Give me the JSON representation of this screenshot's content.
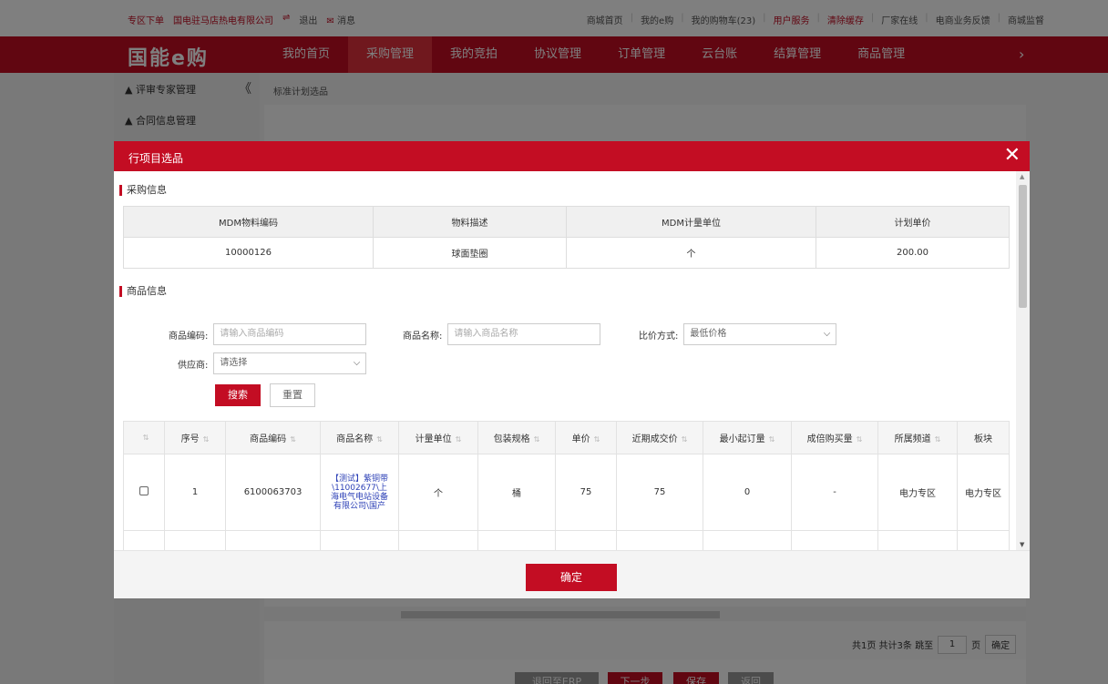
{
  "topbar": {
    "left": [
      "专区下单",
      "国电驻马店热电有限公司",
      "⇌",
      "退出",
      "消息"
    ],
    "right": [
      "商城首页",
      "我的e购",
      "我的购物车(23)",
      "用户服务",
      "清除缓存",
      "厂家在线",
      "电商业务反馈",
      "商城监督"
    ]
  },
  "nav": {
    "logo": "国能e购",
    "items": [
      "我的首页",
      "采购管理",
      "我的竞拍",
      "协议管理",
      "订单管理",
      "云台账",
      "结算管理",
      "商品管理"
    ],
    "active": "采购管理",
    "more": "›"
  },
  "sidebar": {
    "items": [
      "评审专家管理",
      "合同信息管理"
    ],
    "collapse": "《"
  },
  "breadcrumb": "标准计划选品",
  "pagination": {
    "summary": "共1页 共计3条 跳至",
    "page": "1",
    "unit": "页",
    "ok": "确定"
  },
  "bottom_buttons": [
    "退回至ERP",
    "下一步",
    "保存",
    "返回"
  ],
  "modal": {
    "title": "行项目选品",
    "close": "✕",
    "confirm": "确定",
    "purchase_section": "采购信息",
    "purchase_table": {
      "headers": [
        "MDM物料编码",
        "物料描述",
        "MDM计量单位",
        "计划单价"
      ],
      "row": [
        "10000126",
        "球面垫圈",
        "个",
        "200.00"
      ]
    },
    "goods_section": "商品信息",
    "form": {
      "code_label": "商品编码:",
      "code_placeholder": "请输入商品编码",
      "name_label": "商品名称:",
      "name_placeholder": "请输入商品名称",
      "compare_label": "比价方式:",
      "compare_value": "最低价格",
      "supplier_label": "供应商:",
      "supplier_value": "请选择",
      "search": "搜索",
      "reset": "重置"
    },
    "goods_table": {
      "headers": [
        "序号",
        "商品编码",
        "商品名称",
        "计量单位",
        "包装规格",
        "单价",
        "近期成交价",
        "最小起订量",
        "成倍购买量",
        "所属频道",
        "板块"
      ],
      "rows": [
        {
          "index": "1",
          "code": "6100063703",
          "name": "【测试】紫铜带\\11002677\\上海电气电站设备有限公司\\国产",
          "unit": "个",
          "pack": "桶",
          "price": "75",
          "recent_price": "75",
          "min_order": "0",
          "multiple": "-",
          "channel": "电力专区",
          "sector": "电力专区"
        }
      ]
    }
  },
  "colors": {
    "brand": "#c30d23",
    "link": "#2b3fb6"
  }
}
